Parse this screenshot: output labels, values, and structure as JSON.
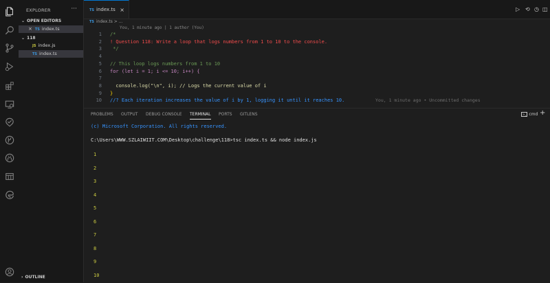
{
  "explorer": {
    "title": "EXPLORER",
    "more": "···",
    "open_editors_label": "OPEN EDITORS",
    "open_editor_file": "index.ts",
    "folder_label": "118",
    "files": [
      {
        "badge": "JS",
        "name": "index.js"
      },
      {
        "badge": "TS",
        "name": "index.ts"
      }
    ],
    "outline_label": "OUTLINE"
  },
  "tab": {
    "badge": "TS",
    "name": "index.ts",
    "close": "×"
  },
  "breadcrumb": {
    "badge": "TS",
    "text": "index.ts > ..."
  },
  "blame_header": "You, 1 minute ago | 1 author (You)",
  "code_lines": [
    {
      "n": "1",
      "text": "/*",
      "color": "#6a9955"
    },
    {
      "n": "2",
      "text": "! Question 118: Write a loop that logs numbers from 1 to 10 to the console.",
      "color": "#f14c4c"
    },
    {
      "n": "3",
      "text": " */",
      "color": "#6a9955"
    },
    {
      "n": "4",
      "text": "",
      "color": "#cccccc"
    },
    {
      "n": "5",
      "text": "// This loop logs numbers from 1 to 10",
      "color": "#6a9955"
    },
    {
      "n": "6",
      "text": "for (let i = 1; i <= 10; i++) {",
      "color": "#c586c0"
    },
    {
      "n": "7",
      "text": "",
      "color": "#cccccc"
    },
    {
      "n": "8",
      "text": "  console.log(\"\\n\", i); // Logs the current value of i",
      "color": "#dcdcaa"
    },
    {
      "n": "9",
      "text": "}",
      "color": "#ffd700"
    },
    {
      "n": "10",
      "text": "//? Each iteration increases the value of i by 1, logging it until it reaches 10.",
      "color": "#3794ff"
    }
  ],
  "inline_blame": "You, 1 minute ago • Uncommitted changes",
  "panel": {
    "tabs": [
      "PROBLEMS",
      "OUTPUT",
      "DEBUG CONSOLE",
      "TERMINAL",
      "PORTS",
      "GITLENS"
    ],
    "active_tab": "TERMINAL",
    "shell_label": "cmd",
    "add": "+"
  },
  "terminal": {
    "copyright": "(c) Microsoft Corporation. All rights reserved.",
    "prompt": "C:\\Users\\WWW.SZLAIWIIT.COM\\Desktop\\challenge\\118>tsc index.ts && node index.js",
    "output": [
      "1",
      "2",
      "3",
      "4",
      "5",
      "6",
      "7",
      "8",
      "9",
      "10"
    ]
  },
  "colors": {
    "accent": "#0078d4",
    "ts": "#3a96dd",
    "js": "#cbcb41",
    "output_number": "#cbcb41"
  }
}
